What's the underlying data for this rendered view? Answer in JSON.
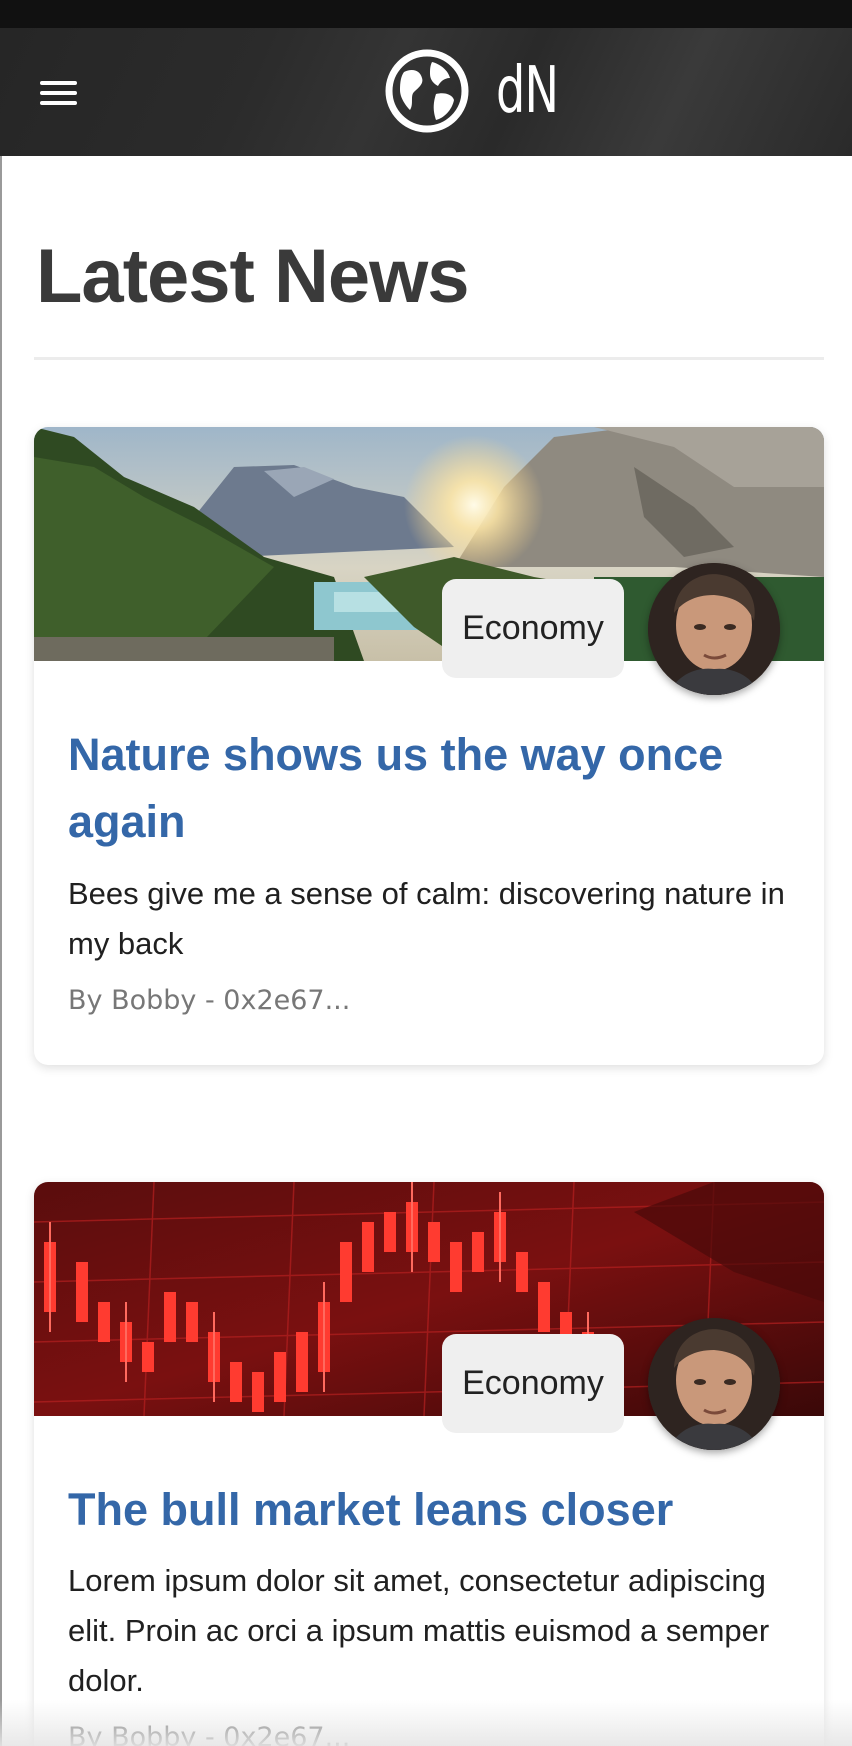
{
  "header": {
    "menu_icon": "hamburger-menu-icon",
    "logo_icon": "globe-icon",
    "logo_text": "dN"
  },
  "page": {
    "title": "Latest News"
  },
  "articles": [
    {
      "image": "mountain-lake-sunrise-image",
      "category": "Economy",
      "title": "Nature shows us the way once again",
      "summary": "Bees give me a sense of calm: discovering nature in my back",
      "byline": "By Bobby - 0x2e67..."
    },
    {
      "image": "red-stock-chart-image",
      "category": "Economy",
      "title": "The bull market leans closer",
      "summary": "Lorem ipsum dolor sit amet, consectetur adipiscing elit. Proin ac orci a ipsum mattis euismod a semper dolor.",
      "byline": "By Bobby - 0x2e67..."
    }
  ],
  "colors": {
    "header_bg": "#2a2a2a",
    "title_link": "#3467a8",
    "badge_bg": "#efefef",
    "byline": "#777777"
  }
}
